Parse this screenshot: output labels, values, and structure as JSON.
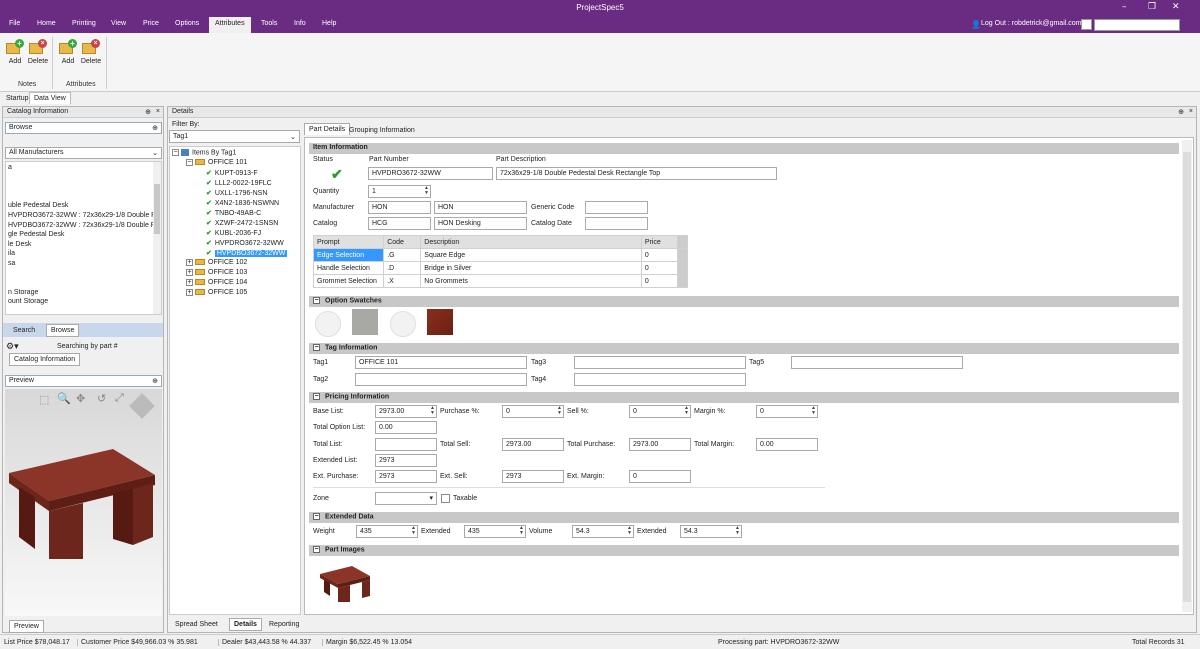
{
  "app_title": "ProjectSpec5",
  "menu": [
    "File",
    "Home",
    "Printing",
    "View",
    "Price",
    "Options",
    "Attributes",
    "Tools",
    "Info",
    "Help"
  ],
  "active_menu": "Attributes",
  "logout": "Log Out : robdetrick@gmail.com",
  "ribbon": {
    "notes": {
      "add": "Add",
      "delete": "Delete",
      "label": "Notes"
    },
    "attributes": {
      "add": "Add",
      "delete": "Delete",
      "label": "Attributes"
    }
  },
  "doc_tabs": [
    "Startup",
    "Data View"
  ],
  "left": {
    "catalog_header": "Catalog Information",
    "browse_header": "Browse",
    "manufacturer": "All Manufacturers",
    "list_items": [
      "a",
      "",
      "",
      "",
      "uble Pedestal Desk",
      "HVPDRO3672-32WW : 72x36x29-1/8 Double P",
      "HVPDBO3672-32WW : 72x36x29-1/8 Double F",
      "gle Pedestal Desk",
      "le Desk",
      "ila",
      "sa",
      "",
      "",
      "n Storage",
      "ount Storage"
    ],
    "tabs": [
      "Search",
      "Browse"
    ],
    "searching": "Searching by part #",
    "catalog_tab": "Catalog Information",
    "preview_header": "Preview",
    "preview_tab": "Preview"
  },
  "details": {
    "header": "Details",
    "filter_label": "Filter By:",
    "filter_value": "Tag1",
    "tree_root": "Items By Tag1",
    "tree_office": "OFFICE 101",
    "tree_parts": [
      "KUPT-0913-F",
      "LLL2-0022-19FLC",
      "UXLL-1796-NSN",
      "X4N2-1836-NSWNN",
      "TNBO-49AB-C",
      "XZWF-2472-1SNSN",
      "KUBL-2036-FJ",
      "HVPDRO3672-32WW",
      "HVPDBO3672-32WW"
    ],
    "tree_offices": [
      "OFFICE 102",
      "OFFICE 103",
      "OFFICE 104",
      "OFFICE 105"
    ],
    "tabs": [
      "Part Details",
      "Grouping Information"
    ],
    "bottom_tabs": [
      "Spread Sheet",
      "Details",
      "Reporting"
    ]
  },
  "item_info": {
    "section": "Item Information",
    "status_label": "Status",
    "part_number_label": "Part Number",
    "part_number": "HVPDRO3672-32WW",
    "part_desc_label": "Part Description",
    "part_desc": "72x36x29-1/8 Double Pedestal Desk  Rectangle Top",
    "quantity_label": "Quantity",
    "quantity": "1",
    "manufacturer_label": "Manufacturer",
    "manufacturer_code": "HON",
    "manufacturer_name": "HON",
    "generic_code_label": "Generic Code",
    "catalog_label": "Catalog",
    "catalog_code": "HCG",
    "catalog_name": "HON Desking",
    "catalog_date_label": "Catalog Date",
    "options_headers": [
      "Prompt",
      "Code",
      "Description",
      "Price"
    ],
    "options": [
      [
        "Edge Selection",
        ".G",
        "Square Edge",
        "0"
      ],
      [
        "Handle Selection",
        ".D",
        "Bridge in Silver",
        "0"
      ],
      [
        "Grommet Selection",
        ".X",
        "No Grommets",
        "0"
      ]
    ]
  },
  "swatches": {
    "section": "Option Swatches"
  },
  "tags": {
    "section": "Tag Information",
    "tag1_label": "Tag1",
    "tag1": "OFFICE 101",
    "tag2_label": "Tag2",
    "tag3_label": "Tag3",
    "tag4_label": "Tag4",
    "tag5_label": "Tag5"
  },
  "pricing": {
    "section": "Pricing Information",
    "base_list_label": "Base List:",
    "base_list": "2973.00",
    "purchase_pct_label": "Purchase %:",
    "purchase_pct": "0",
    "sell_pct_label": "Sell %:",
    "sell_pct": "0",
    "margin_pct_label": "Margin %:",
    "margin_pct": "0",
    "total_option_label": "Total Option List:",
    "total_option": "0.00",
    "total_list_label": "Total List:",
    "total_sell_label": "Total Sell:",
    "total_sell": "2973.00",
    "total_purchase_label": "Total Purchase:",
    "total_purchase": "2973.00",
    "total_margin_label": "Total Margin:",
    "total_margin": "0.00",
    "extended_list_label": "Extended List:",
    "extended_list": "2973",
    "ext_purchase_label": "Ext. Purchase:",
    "ext_purchase": "2973",
    "ext_sell_label": "Ext. Sell:",
    "ext_sell": "2973",
    "ext_margin_label": "Ext. Margin:",
    "ext_margin": "0",
    "zone_label": "Zone",
    "taxable_label": "Taxable"
  },
  "extended": {
    "section": "Extended Data",
    "weight_label": "Weight",
    "weight": "435",
    "extended_label": "Extended",
    "extended_weight": "435",
    "volume_label": "Volume",
    "volume": "54.3",
    "extended2_label": "Extended",
    "extended_volume": "54.3"
  },
  "images": {
    "section": "Part Images"
  },
  "status": {
    "list_price": "List Price  $78,048.17",
    "customer_price": "Customer Price  $49,966.03  %  35.981",
    "dealer": "Dealer  $43,443.58  %  44.337",
    "margin": "Margin  $6,522.45  %  13.054",
    "processing": "Processing part: HVPDRO3672-32WW",
    "total_records": "Total Records  31"
  },
  "colors": {
    "accent": "#6a2b83",
    "selection": "#3399ff",
    "check": "#2e9b2e",
    "wood": "#7a2a1e"
  }
}
